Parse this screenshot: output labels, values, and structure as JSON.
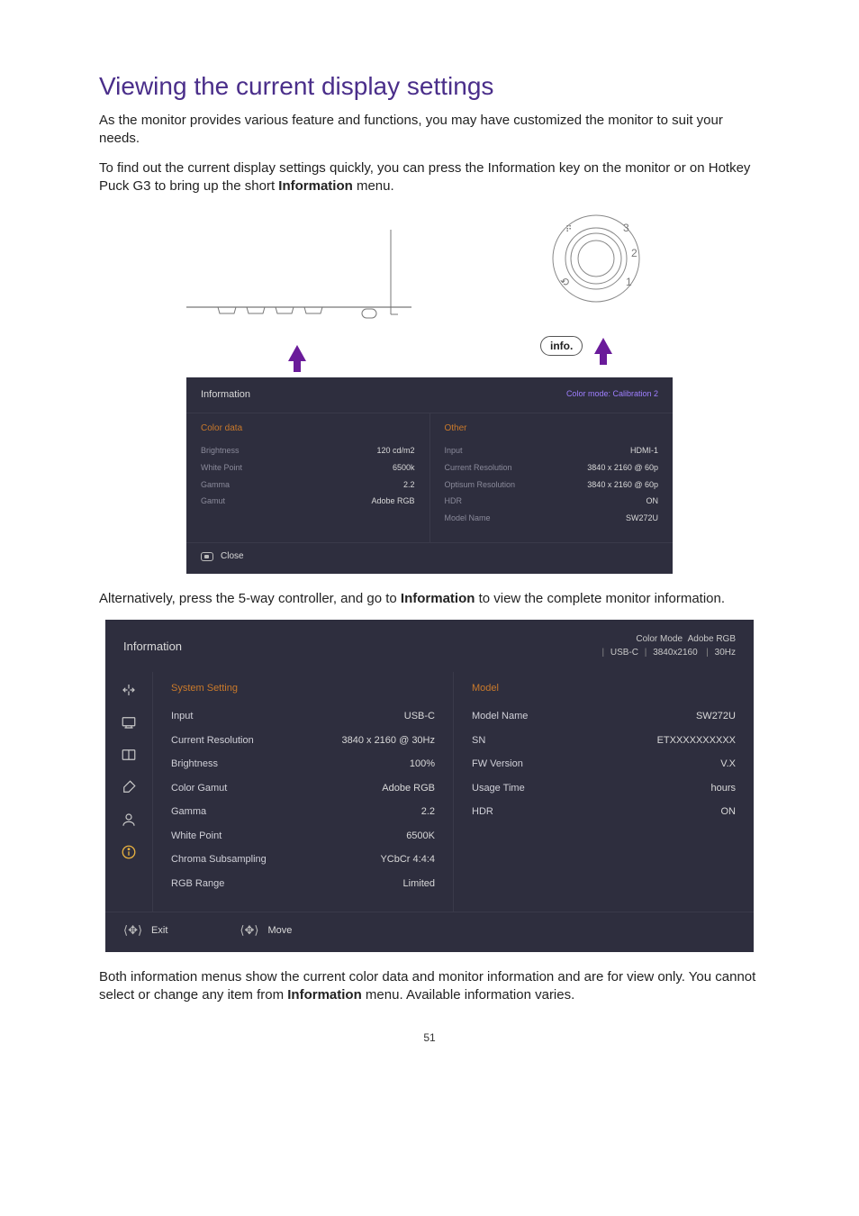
{
  "heading": "Viewing the current display settings",
  "para1a": "As the monitor provides various feature and functions, you may have customized the monitor to suit your needs.",
  "para1b_before": "To find out the current display settings quickly, you can press the Information key on the monitor or on Hotkey Puck G3 to bring up the short ",
  "para1b_bold": "Information",
  "para1b_after": " menu.",
  "info_label": "info.",
  "osd1": {
    "title": "Information",
    "mode": "Color mode: Calibration 2",
    "left": {
      "heading": "Color data",
      "rows": [
        {
          "label": "Brightness",
          "value": "120 cd/m2"
        },
        {
          "label": "White Point",
          "value": "6500k"
        },
        {
          "label": "Gamma",
          "value": "2.2"
        },
        {
          "label": "Gamut",
          "value": "Adobe RGB"
        }
      ]
    },
    "right": {
      "heading": "Other",
      "rows": [
        {
          "label": "Input",
          "value": "HDMI-1"
        },
        {
          "label": "Current Resolution",
          "value": "3840 x 2160 @ 60p"
        },
        {
          "label": "Optisum Resolution",
          "value": "3840 x 2160 @ 60p"
        },
        {
          "label": "HDR",
          "value": "ON"
        },
        {
          "label": "Model Name",
          "value": "SW272U"
        }
      ]
    },
    "close": "Close"
  },
  "para2_before": "Alternatively, press the 5-way controller, and go to ",
  "para2_bold": "Information",
  "para2_after": " to view the complete monitor information.",
  "osd2": {
    "title": "Information",
    "status": {
      "line1_label": "Color Mode",
      "line1_value": "Adobe RGB",
      "line2_a": "USB-C",
      "line2_b": "3840x2160",
      "line2_c": "30Hz"
    },
    "left": {
      "heading": "System Setting",
      "rows": [
        {
          "label": "Input",
          "value": "USB-C"
        },
        {
          "label": "Current Resolution",
          "value": "3840 x 2160 @ 30Hz"
        },
        {
          "label": "Brightness",
          "value": "100%"
        },
        {
          "label": "Color Gamut",
          "value": "Adobe RGB"
        },
        {
          "label": "Gamma",
          "value": "2.2"
        },
        {
          "label": "White Point",
          "value": "6500K"
        },
        {
          "label": "Chroma Subsampling",
          "value": "YCbCr 4:4:4"
        },
        {
          "label": "RGB Range",
          "value": "Limited"
        }
      ]
    },
    "right": {
      "heading": "Model",
      "rows": [
        {
          "label": "Model Name",
          "value": "SW272U"
        },
        {
          "label": "SN",
          "value": "ETXXXXXXXXXX"
        },
        {
          "label": "FW Version",
          "value": "V.X"
        },
        {
          "label": "Usage Time",
          "value": "hours"
        },
        {
          "label": "HDR",
          "value": "ON"
        }
      ]
    },
    "footer": {
      "exit": "Exit",
      "move": "Move"
    }
  },
  "para3_before": "Both information menus show the current color data and monitor information and are for view only. You cannot select or change any item from ",
  "para3_bold": "Information",
  "para3_after": " menu. Available information varies.",
  "page_number": "51"
}
